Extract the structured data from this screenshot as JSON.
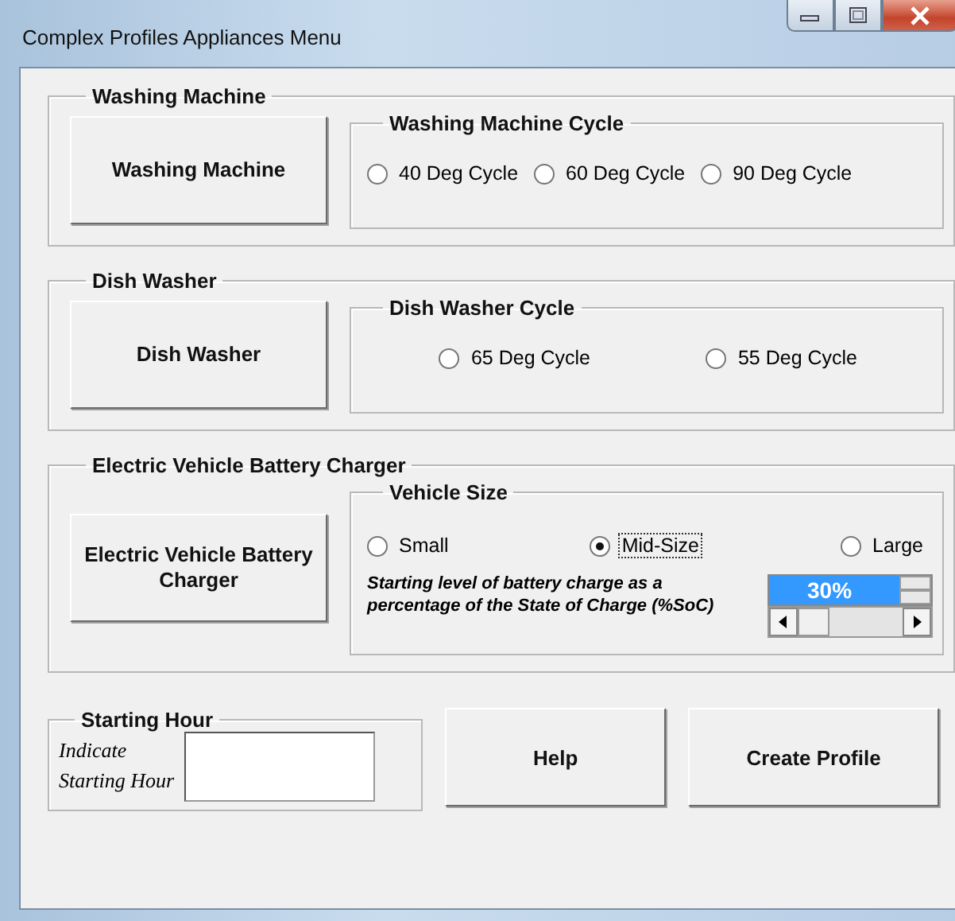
{
  "window": {
    "title": "Complex Profiles Appliances Menu"
  },
  "sections": [
    {
      "kind": "cycle",
      "title": "Washing Machine",
      "button": "Washing Machine",
      "options_title": "Washing Machine Cycle",
      "options": [
        {
          "label": "40 Deg Cycle",
          "selected": false,
          "focused": false
        },
        {
          "label": "60 Deg Cycle",
          "selected": false,
          "focused": false
        },
        {
          "label": "90 Deg Cycle",
          "selected": false,
          "focused": false
        }
      ]
    },
    {
      "kind": "cycle",
      "title": "Dish Washer",
      "button": "Dish Washer",
      "options_title": "Dish Washer Cycle",
      "options": [
        {
          "label": "65 Deg Cycle",
          "selected": false,
          "focused": false
        },
        {
          "label": "55 Deg Cycle",
          "selected": false,
          "focused": false
        }
      ]
    },
    {
      "kind": "vehicle",
      "title": "Electric Vehicle Battery Charger",
      "button": "Electric Vehicle Battery Charger",
      "options_title": "Vehicle Size",
      "options": [
        {
          "label": "Small",
          "selected": false,
          "focused": false
        },
        {
          "label": "Mid-Size",
          "selected": true,
          "focused": true
        },
        {
          "label": "Large",
          "selected": false,
          "focused": false
        }
      ],
      "note": "Starting level of battery charge as a percentage of the State of Charge (%SoC)",
      "soc_value": "30%"
    }
  ],
  "starting_hour": {
    "title": "Starting Hour",
    "label_lines": [
      "Indicate",
      "Starting Hour"
    ]
  },
  "buttons": [
    "Help",
    "Create Profile"
  ]
}
